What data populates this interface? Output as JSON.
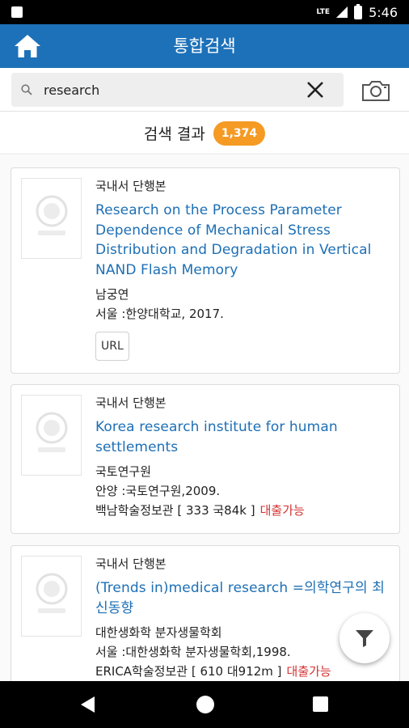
{
  "status_bar": {
    "network": "LTE",
    "time": "5:46"
  },
  "app_bar": {
    "title": "통합검색",
    "home_icon": "home-icon"
  },
  "search": {
    "value": "research",
    "search_icon": "search-icon",
    "clear_icon": "close-icon",
    "camera_icon": "camera-icon"
  },
  "results": {
    "label": "검색 결과",
    "count": "1,374"
  },
  "items": [
    {
      "type": "국내서 단행본",
      "title": "Research on the Process Parameter Dependence of Mechanical Stress Distribution and Degradation in Vertical NAND Flash Memory",
      "author": "남궁연",
      "publisher": "서울 :한양대학교, 2017.",
      "url_label": "URL"
    },
    {
      "type": "국내서 단행본",
      "title": "Korea research institute for human settlements",
      "author": "국토연구원",
      "publisher": "안양 :국토연구원,2009.",
      "holding": "백남학술정보관 [ 333 국84k ]",
      "status": "대출가능"
    },
    {
      "type": "국내서 단행본",
      "title": "(Trends in)medical research =의학연구의 최신동향",
      "author": "대한생화학 분자생물학회",
      "publisher": "서울 :대한생화학 분자생물학회,1998.",
      "holding": "ERICA학술정보관 [ 610 대912m ]",
      "status": "대출가능"
    }
  ],
  "colors": {
    "app_bar": "#1d71b8",
    "title_link": "#1d6fb5",
    "count_badge": "#f59a23",
    "loan_status": "#d43232"
  },
  "fab": {
    "icon": "filter-icon"
  },
  "nav_bar": {
    "back_icon": "back-triangle-icon",
    "home_icon": "home-circle-icon",
    "recent_icon": "recents-square-icon"
  }
}
